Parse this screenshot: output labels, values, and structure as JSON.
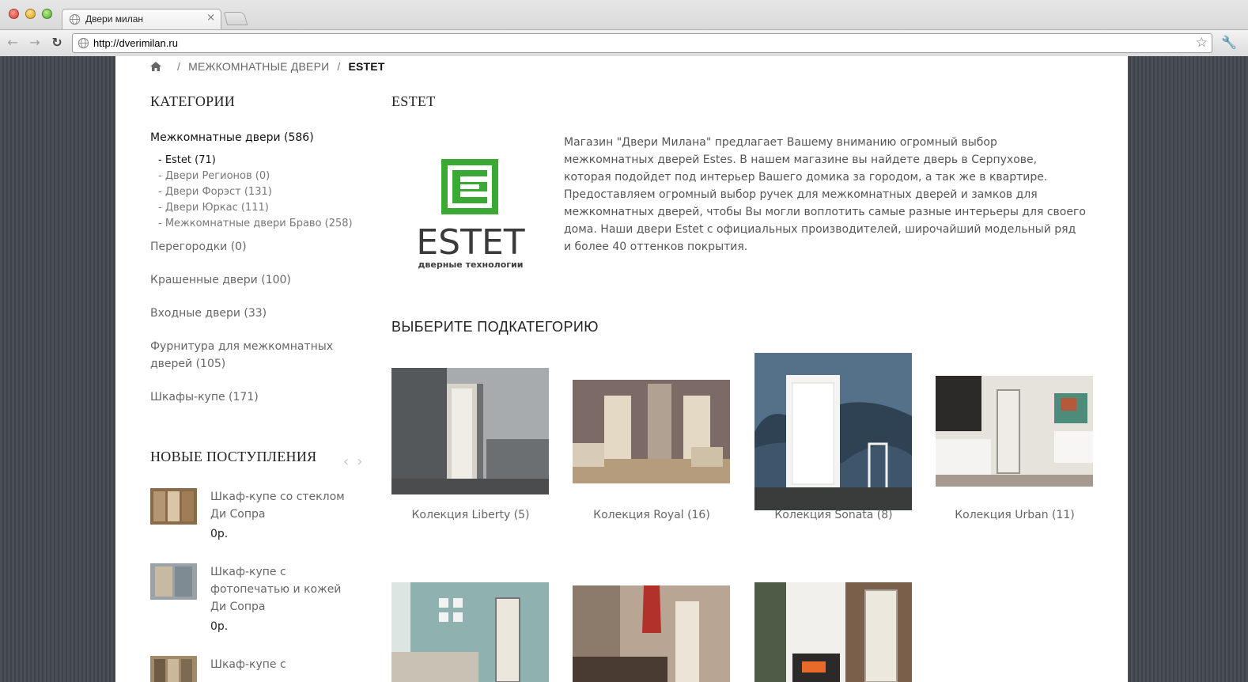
{
  "browser": {
    "tab_title": "Двери милан",
    "url": "http://dverimilan.ru"
  },
  "breadcrumb": {
    "home_icon": "home-icon",
    "items": [
      "МЕЖКОМНАТНЫЕ ДВЕРИ",
      "ESTET"
    ]
  },
  "sidebar": {
    "categories_title": "КАТЕГОРИИ",
    "categories": [
      {
        "label": "Межкомнатные двери (586)"
      },
      {
        "label": "Перегородки (0)"
      },
      {
        "label": "Крашенные двери (100)"
      },
      {
        "label": "Входные двери (33)"
      },
      {
        "label": "Фурнитура для межкомнатных дверей (105)"
      },
      {
        "label": "Шкафы-купе (171)"
      }
    ],
    "subcategories": [
      {
        "label": "- Estet (71)"
      },
      {
        "label": "- Двери Регионов (0)"
      },
      {
        "label": "- Двери Форэст (131)"
      },
      {
        "label": "- Двери Юркас (111)"
      },
      {
        "label": "- Межкомнатные двери Браво (258)"
      }
    ],
    "new_title": "НОВЫЕ ПОСТУПЛЕНИЯ",
    "new_items": [
      {
        "name": "Шкаф-купе со стеклом Ди Сопра",
        "price": "0р."
      },
      {
        "name": "Шкаф-купе с фотопечатью и кожей Ди Сопра",
        "price": "0р."
      },
      {
        "name": "Шкаф-купе с",
        "price": ""
      }
    ]
  },
  "main": {
    "title": "ESTET",
    "logo_text": "ESTET",
    "logo_subtext": "дверные технологии",
    "description": "Магазин \"Двери Милана\" предлагает Вашему вниманию огромный выбор межкомнатных дверей Estes. В нашем магазине вы найдете дверь в Серпухове, которая подойдет под интерьер Вашего домика за городом, а так же в квартире. Предоставляем огромный выбор ручек для межкомнатных дверей и замков для межкомнатных дверей, чтобы Вы могли воплотить самые разные интерьеры для своего дома. Наши двери Estet с официальных производителей, широчайший модельный ряд и более 40 оттенков покрытия.",
    "subcategory_title": "ВЫБЕРИТЕ ПОДКАТЕГОРИЮ",
    "collections": [
      {
        "label": "Колекция Liberty (5)"
      },
      {
        "label": "Колекция Royal (16)"
      },
      {
        "label": "Колекция Sonata (8)"
      },
      {
        "label": "Колекция Urban (11)"
      },
      {
        "label": ""
      },
      {
        "label": ""
      },
      {
        "label": ""
      }
    ]
  },
  "colors": {
    "logo_green": "#3aa935",
    "logo_dark": "#3b3b3b"
  }
}
